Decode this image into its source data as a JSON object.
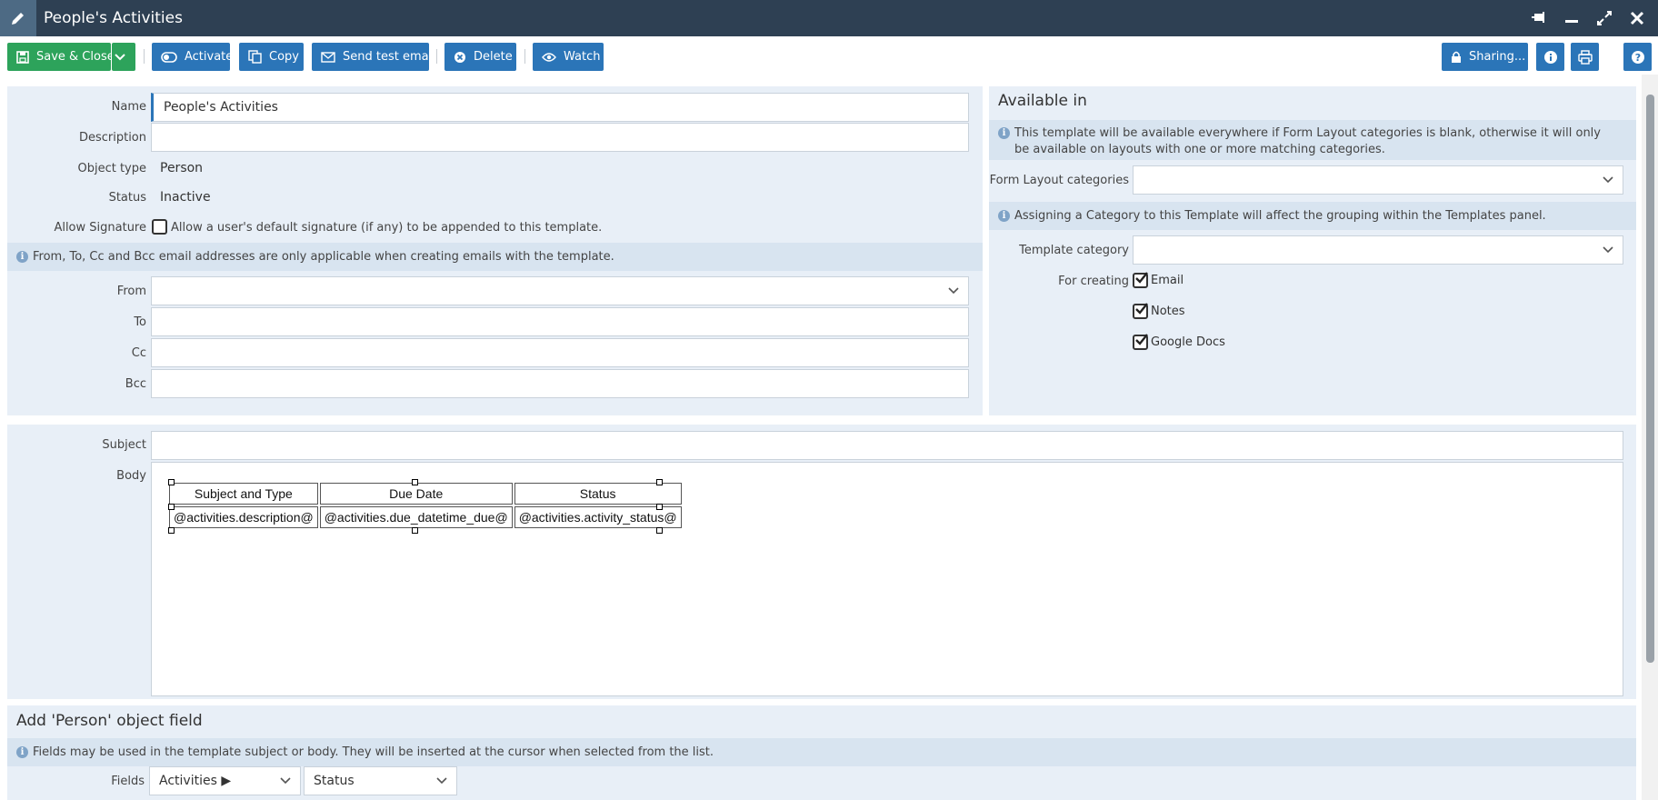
{
  "window": {
    "title": "People's Activities"
  },
  "toolbar": {
    "save_close": "Save & Close",
    "activate": "Activate",
    "copy": "Copy",
    "send_test_email": "Send test email",
    "delete": "Delete",
    "watch": "Watch",
    "sharing": "Sharing..."
  },
  "details": {
    "name_label": "Name",
    "name_value": "People's Activities",
    "description_label": "Description",
    "description_value": "",
    "object_type_label": "Object type",
    "object_type_value": "Person",
    "status_label": "Status",
    "status_value": "Inactive",
    "allow_signature_label": "Allow Signature",
    "allow_signature_text": "Allow a user's default signature (if any) to be appended to this template.",
    "allow_signature_checked": false,
    "email_info": "From, To, Cc and Bcc email addresses are only applicable when creating emails with the template.",
    "from_label": "From",
    "to_label": "To",
    "cc_label": "Cc",
    "bcc_label": "Bcc"
  },
  "available": {
    "heading": "Available in",
    "info": "This template will be available everywhere if Form Layout categories is blank, otherwise it will only be available on layouts with one or more matching categories.",
    "form_layout_label": "Form Layout categories",
    "category_info": "Assigning a Category to this Template will affect the grouping within the Templates panel.",
    "template_category_label": "Template category",
    "for_creating_label": "For creating",
    "options": [
      {
        "label": "Email",
        "checked": true
      },
      {
        "label": "Notes",
        "checked": true
      },
      {
        "label": "Google Docs",
        "checked": true
      }
    ]
  },
  "content": {
    "subject_label": "Subject",
    "body_label": "Body",
    "table_headers": [
      "Subject and Type",
      "Due Date",
      "Status"
    ],
    "table_row": [
      "@activities.description@",
      "@activities.due_datetime_due@",
      "@activities.activity_status@"
    ]
  },
  "fields_panel": {
    "heading": "Add 'Person' object field",
    "info": "Fields may be used in the template subject or body. They will be inserted at the cursor when selected from the list.",
    "fields_label": "Fields",
    "field_select": "Activities ▶",
    "subfield_select": "Status"
  },
  "colors": {
    "titlebar": "#2e4053",
    "primary_button": "#2b75b8",
    "save_button": "#2da35b",
    "panel": "#e8eff7",
    "info_band": "#d8e4f0"
  }
}
